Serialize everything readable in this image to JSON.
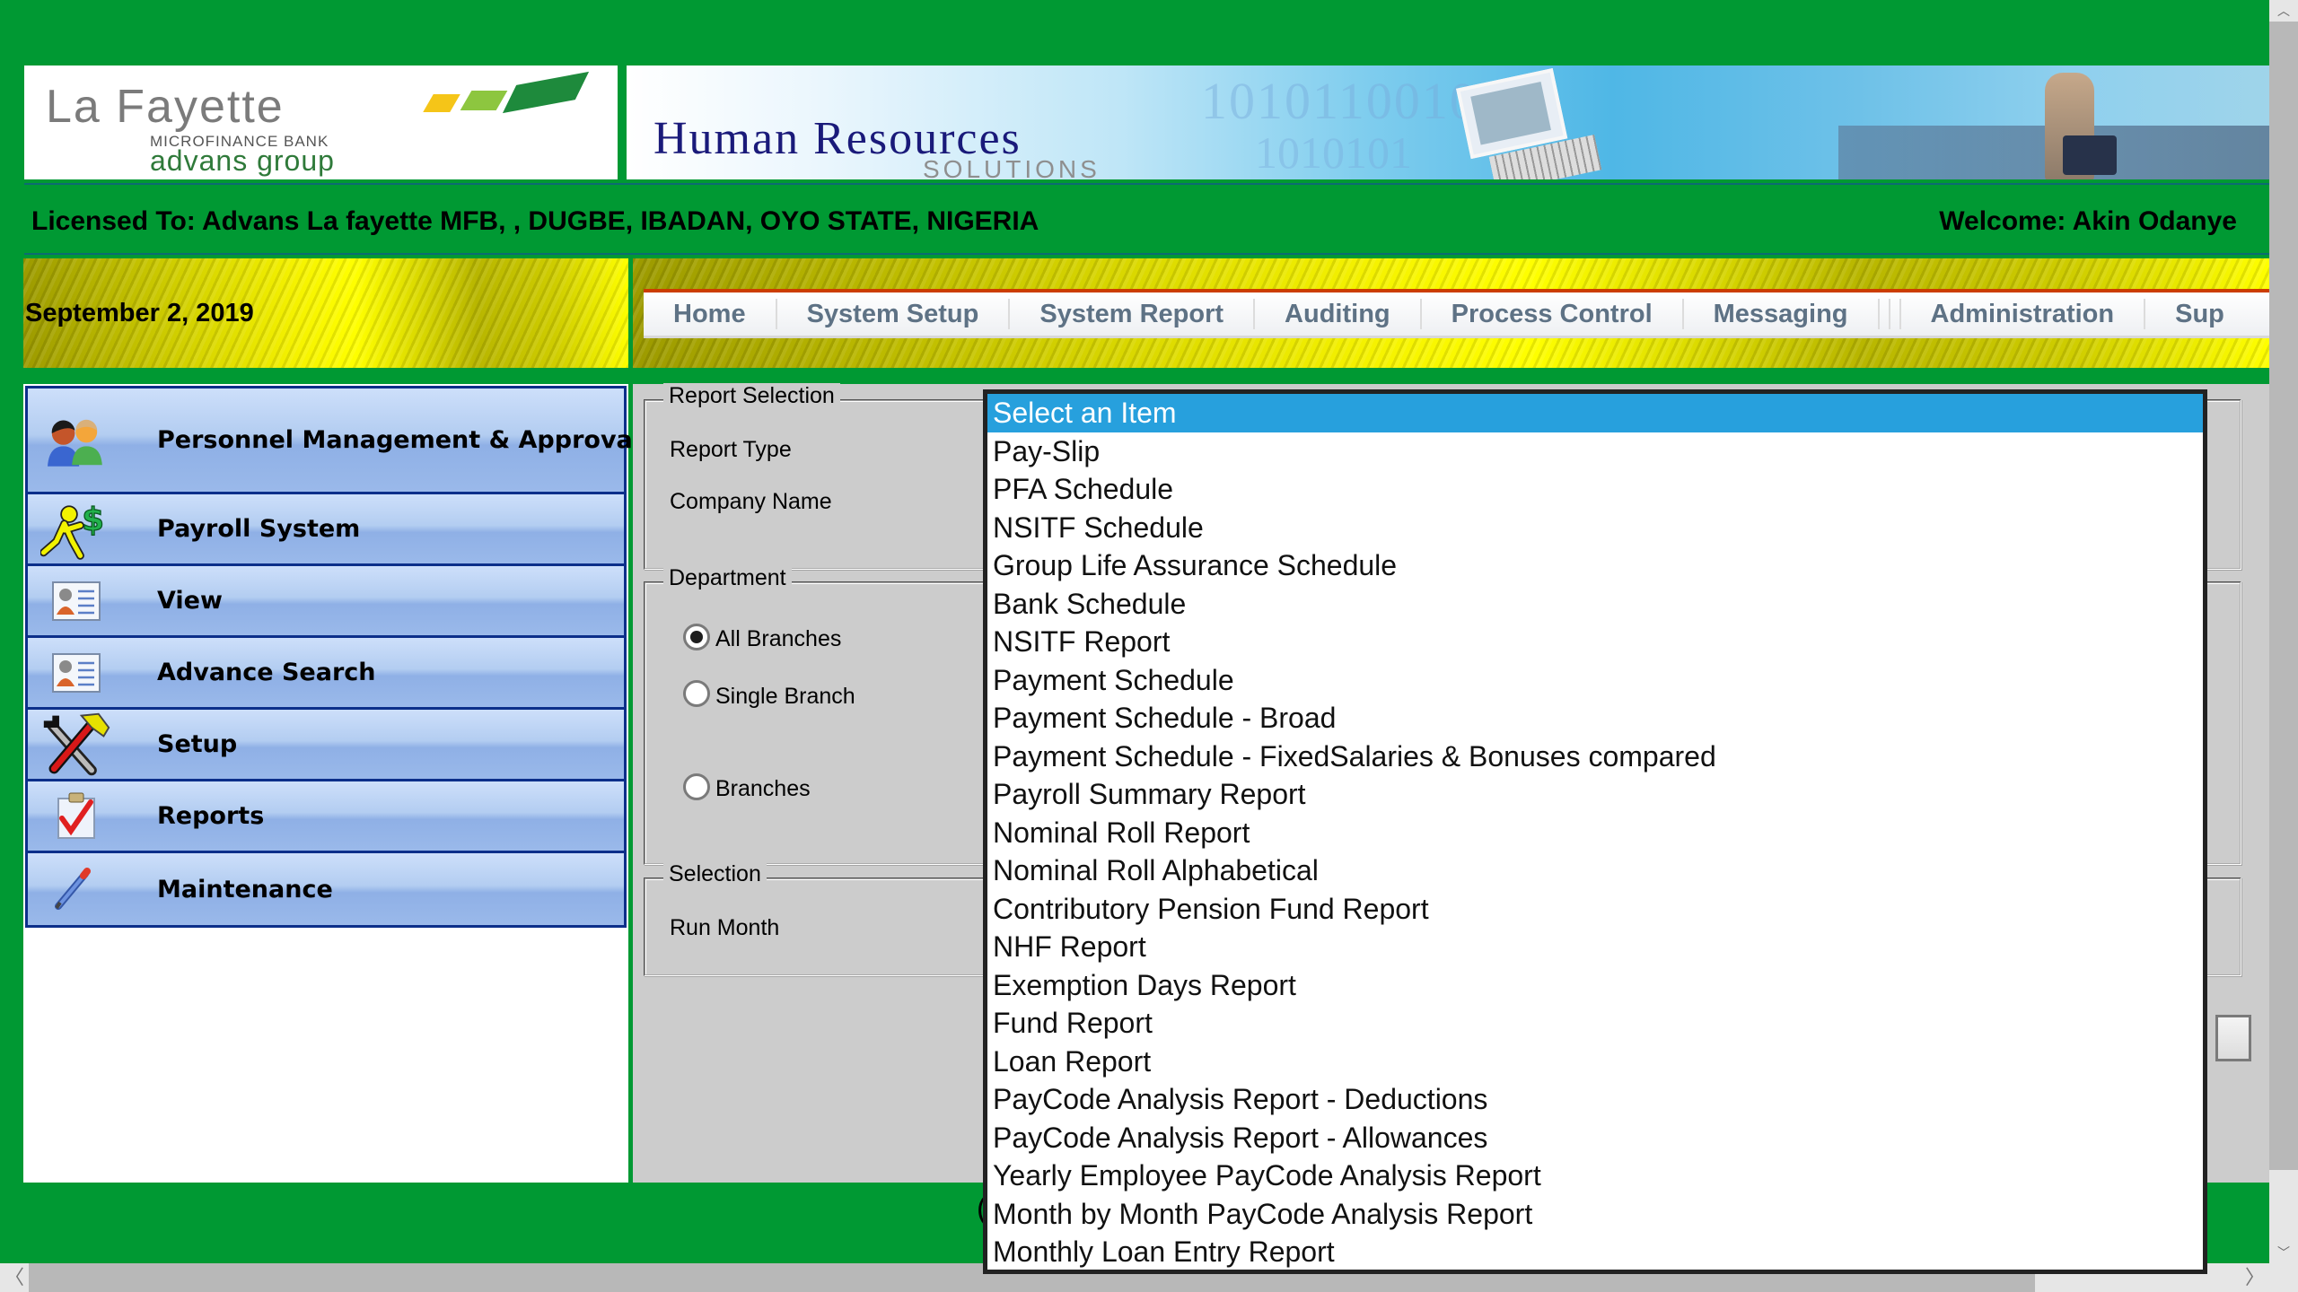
{
  "header": {
    "logo": {
      "name": "La Fayette",
      "subtitle": "MICROFINANCE BANK",
      "group": "advans group"
    },
    "banner": {
      "title": "Human Resources",
      "subtitle": "SOLUTIONS",
      "digits_top": "1010110010",
      "digits_bottom": "1010101"
    }
  },
  "license_bar": {
    "licensed_to": "Licensed To: Advans La fayette MFB, , DUGBE, IBADAN, OYO STATE, NIGERIA",
    "welcome": "Welcome: Akin Odanye"
  },
  "date": "September 2, 2019",
  "nav": {
    "items": [
      {
        "label": "Home"
      },
      {
        "label": "System Setup"
      },
      {
        "label": "System Report"
      },
      {
        "label": "Auditing"
      },
      {
        "label": "Process Control"
      },
      {
        "label": "Messaging"
      },
      {
        "label": "Administration"
      },
      {
        "label": "Sup"
      }
    ]
  },
  "sidebar": {
    "items": [
      {
        "label": "Personnel Management & Approval",
        "icon": "people-icon"
      },
      {
        "label": "Payroll System",
        "icon": "running-man-dollar-icon"
      },
      {
        "label": "View",
        "icon": "id-card-icon"
      },
      {
        "label": "Advance Search",
        "icon": "id-card-icon"
      },
      {
        "label": "Setup",
        "icon": "tools-icon"
      },
      {
        "label": "Reports",
        "icon": "clipboard-check-icon"
      },
      {
        "label": "Maintenance",
        "icon": "pencil-icon"
      }
    ]
  },
  "form": {
    "report_selection": {
      "legend": "Report Selection",
      "report_type_label": "Report Type",
      "company_name_label": "Company Name"
    },
    "department": {
      "legend": "Department",
      "options": [
        {
          "label": "All Branches",
          "checked": true
        },
        {
          "label": "Single Branch",
          "checked": false
        },
        {
          "label": "Branches",
          "checked": false
        }
      ]
    },
    "selection": {
      "legend": "Selection",
      "run_month_label": "Run Month"
    }
  },
  "report_type_dropdown": {
    "selected": "Select an Item",
    "options": [
      "Select an Item",
      "Pay-Slip",
      "PFA Schedule",
      "NSITF Schedule",
      "Group Life Assurance Schedule",
      "Bank Schedule",
      "NSITF Report",
      "Payment Schedule",
      "Payment Schedule - Broad",
      "Payment Schedule - FixedSalaries & Bonuses compared",
      "Payroll Summary Report",
      "Nominal Roll Report",
      "Nominal Roll Alphabetical",
      "Contributory Pension Fund Report",
      "NHF Report",
      "Exemption Days Report",
      "Fund Report",
      "Loan Report",
      "PayCode Analysis Report - Deductions",
      "PayCode Analysis Report - Allowances",
      "Yearly Employee PayCode Analysis Report",
      "Month by Month PayCode Analysis Report",
      "Monthly Loan Entry Report"
    ]
  },
  "footer": {
    "glyph": "("
  },
  "scrollbars": {
    "up": "︿",
    "down": "﹀",
    "left": "〈",
    "right": "〉"
  },
  "colors": {
    "brand_green": "#009933",
    "nav_accent": "#cc3d00",
    "nav_text": "#5e7285",
    "selected_option": "#27a0dd",
    "sidebar_border": "#0c2f8a",
    "panel_gray": "#cccccc"
  }
}
